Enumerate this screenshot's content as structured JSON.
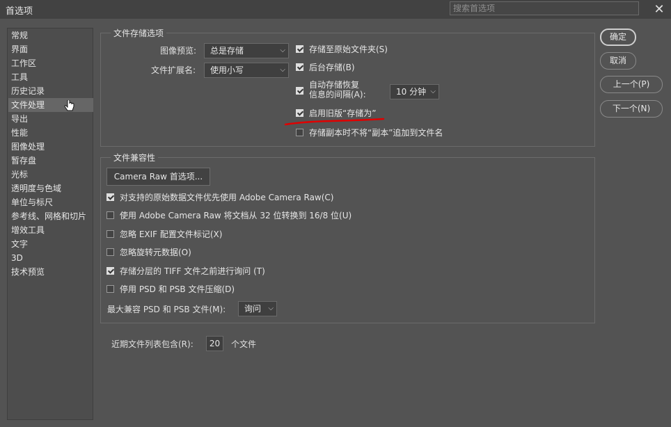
{
  "window": {
    "title": "首选项",
    "search_placeholder": "搜索首选项"
  },
  "sidebar": {
    "items": [
      {
        "label": "常规"
      },
      {
        "label": "界面"
      },
      {
        "label": "工作区"
      },
      {
        "label": "工具"
      },
      {
        "label": "历史记录"
      },
      {
        "label": "文件处理",
        "selected": true
      },
      {
        "label": "导出"
      },
      {
        "label": "性能"
      },
      {
        "label": "图像处理"
      },
      {
        "label": "暂存盘"
      },
      {
        "label": "光标"
      },
      {
        "label": "透明度与色域"
      },
      {
        "label": "单位与标尺"
      },
      {
        "label": "参考线、网格和切片"
      },
      {
        "label": "增效工具"
      },
      {
        "label": "文字"
      },
      {
        "label": "3D"
      },
      {
        "label": "技术预览"
      }
    ]
  },
  "file_save": {
    "legend": "文件存储选项",
    "image_preview_label": "图像预览:",
    "image_preview_value": "总是存储",
    "file_ext_label": "文件扩展名:",
    "file_ext_value": "使用小写",
    "save_to_original": {
      "label": "存储至原始文件夹(S)",
      "checked": true
    },
    "background_save": {
      "label": "后台存储(B)",
      "checked": true
    },
    "autosave": {
      "label_line1": "自动存储恢复",
      "label_line2": "信息的间隔(A):",
      "checked": true,
      "interval": "10 分钟"
    },
    "legacy_save_as": {
      "label": "启用旧版“存储为”",
      "checked": true
    },
    "no_copy_suffix": {
      "label": "存储副本时不将“副本”追加到文件名",
      "checked": false
    }
  },
  "compat": {
    "legend": "文件兼容性",
    "camera_raw_button": "Camera Raw 首选项...",
    "options": [
      {
        "label": "对支持的原始数据文件优先使用 Adobe Camera Raw(C)",
        "checked": true
      },
      {
        "label": "使用 Adobe Camera Raw 将文档从 32 位转换到 16/8 位(U)",
        "checked": false
      },
      {
        "label": "忽略 EXIF 配置文件标记(X)",
        "checked": false
      },
      {
        "label": "忽略旋转元数据(O)",
        "checked": false
      },
      {
        "label": "存储分层的 TIFF 文件之前进行询问 (T)",
        "checked": true
      },
      {
        "label": "停用 PSD 和 PSB 文件压缩(D)",
        "checked": false
      }
    ],
    "max_compat_label": "最大兼容 PSD 和 PSB 文件(M):",
    "max_compat_value": "询问"
  },
  "recent": {
    "label": "近期文件列表包含(R):",
    "value": "20",
    "suffix": "个文件"
  },
  "buttons": {
    "ok": "确定",
    "cancel": "取消",
    "prev": "上一个(P)",
    "next": "下一个(N)"
  },
  "colors": {
    "background": "#535353",
    "titlebar": "#424242",
    "annotation": "#e00000"
  }
}
